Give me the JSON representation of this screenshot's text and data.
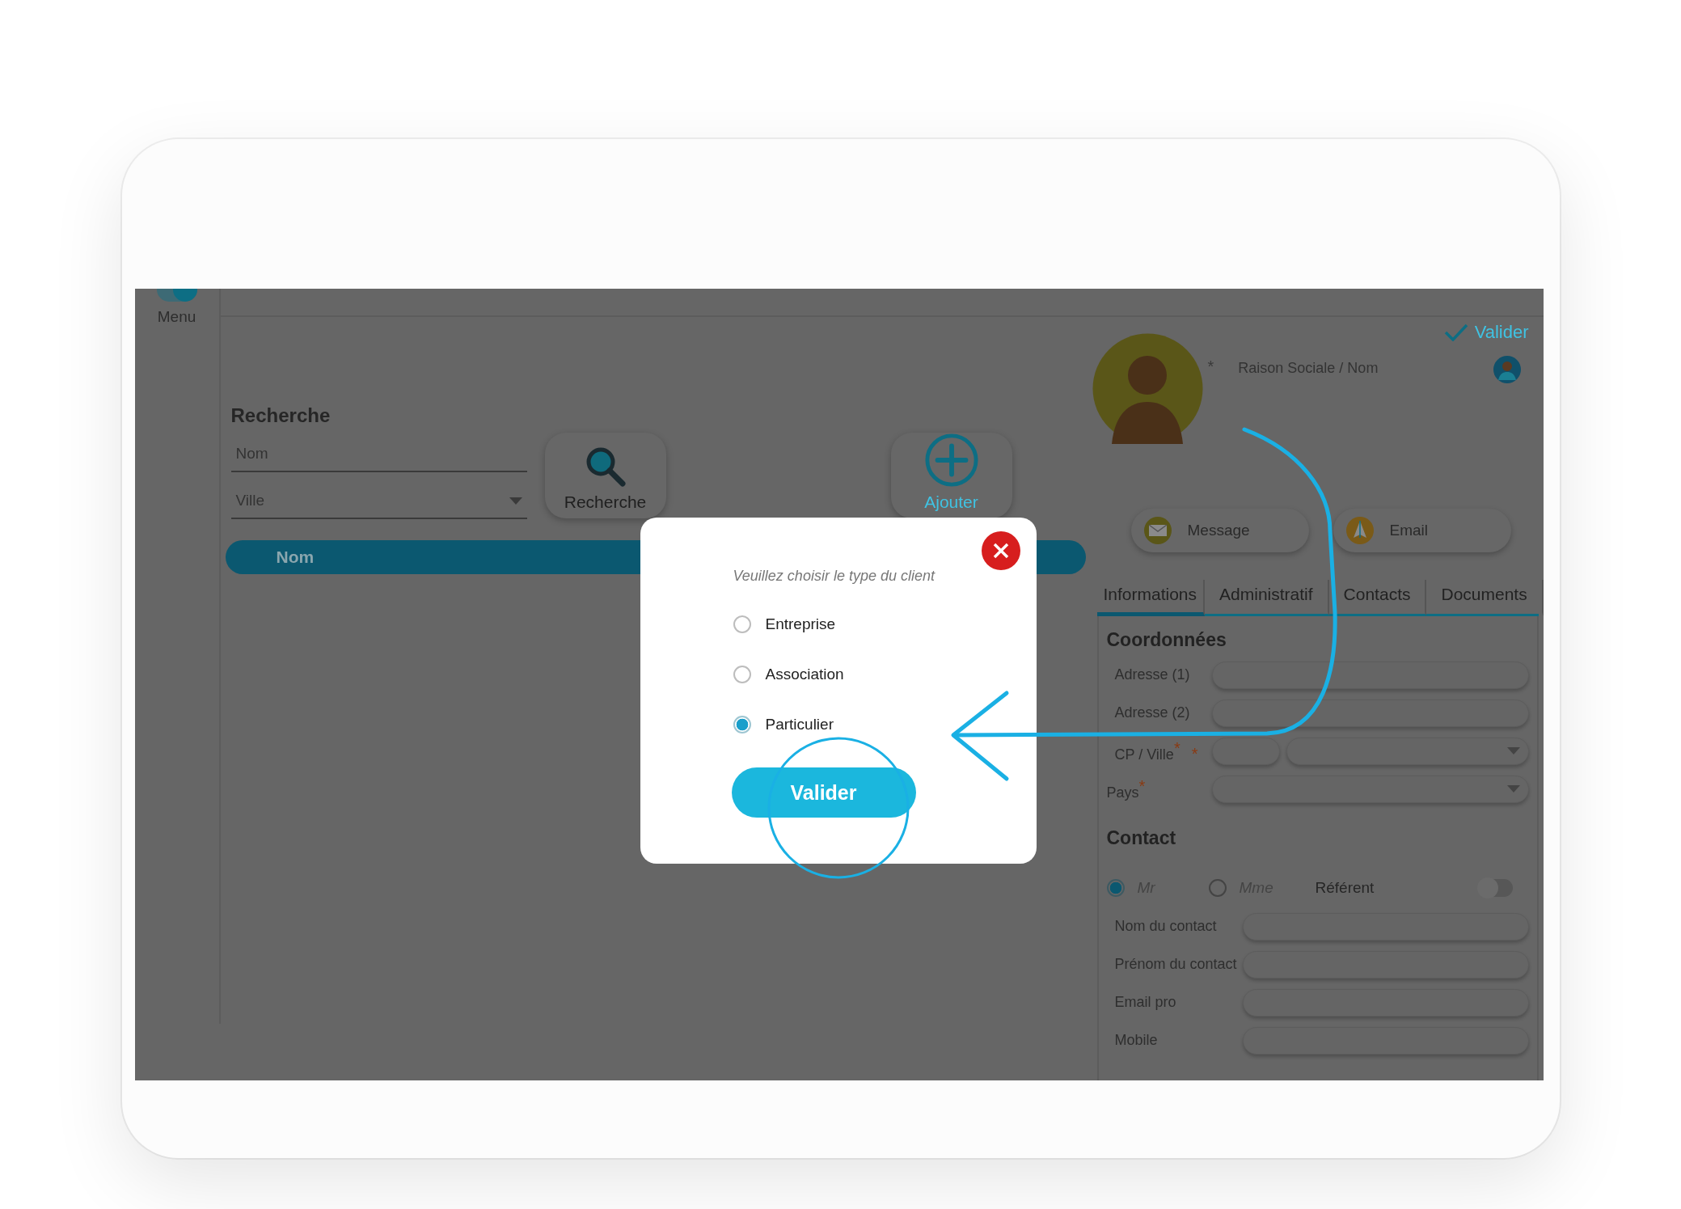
{
  "sidebar": {
    "label": "Menu",
    "toggle_on": true
  },
  "search": {
    "title": "Recherche",
    "name_field": {
      "placeholder": "Nom"
    },
    "city_select": {
      "placeholder": "Ville"
    },
    "search_button": "Recherche",
    "add_button": "Ajouter"
  },
  "results_table": {
    "columns": [
      "Nom"
    ]
  },
  "client_panel": {
    "validate_label": "Valider",
    "required_mark": "*",
    "name_placeholder": "Raison Sociale / Nom",
    "actions": [
      {
        "label": "Message",
        "kind": "message"
      },
      {
        "label": "Email",
        "kind": "email"
      }
    ],
    "tabs": [
      {
        "label": "Informations",
        "selected": true
      },
      {
        "label": "Administratif",
        "selected": false
      },
      {
        "label": "Contacts",
        "selected": false
      },
      {
        "label": "Documents",
        "selected": false
      }
    ],
    "address_section": {
      "title": "Coordonnées",
      "fields": [
        {
          "label": "Adresse (1)",
          "kind": "text",
          "required": false
        },
        {
          "label": "Adresse (2)",
          "kind": "text",
          "required": false
        },
        {
          "label": "CP / Ville",
          "kind": "postcode_city",
          "required": true,
          "city_required": true
        },
        {
          "label": "Pays",
          "kind": "select",
          "required": true
        }
      ]
    },
    "contact_section": {
      "title": "Contact",
      "civility": [
        {
          "label": "Mr",
          "selected": true
        },
        {
          "label": "Mme",
          "selected": false
        }
      ],
      "referent": {
        "label": "Référent",
        "on": false
      },
      "fields": [
        "Nom du contact",
        "Prénom du contact",
        "Email pro",
        "Mobile"
      ]
    }
  },
  "dialog": {
    "prompt": "Veuillez choisir le type du client",
    "options": [
      {
        "label": "Entreprise",
        "selected": false
      },
      {
        "label": "Association",
        "selected": false
      },
      {
        "label": "Particulier",
        "selected": true
      }
    ],
    "button": "Valider"
  }
}
